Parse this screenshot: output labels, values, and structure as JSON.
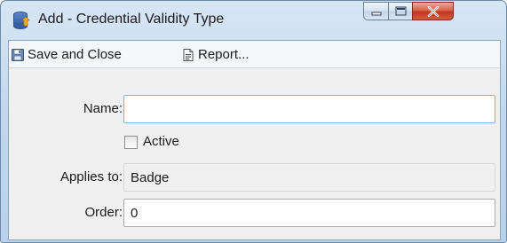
{
  "window": {
    "title": "Add - Credential Validity Type",
    "app_icon": "database-stack-icon",
    "caption_buttons": [
      "minimize-icon",
      "maximize-icon",
      "close-icon"
    ]
  },
  "toolbar": {
    "save_label": "Save and Close",
    "save_icon": "floppy-disk-icon",
    "report_label": "Report...",
    "report_icon": "report-document-icon"
  },
  "form": {
    "name": {
      "label": "Name:",
      "value": ""
    },
    "active": {
      "label": "Active",
      "checked": false
    },
    "applies_to": {
      "label": "Applies to:",
      "value": "Badge"
    },
    "order": {
      "label": "Order:",
      "value": "0"
    }
  },
  "colors": {
    "frame_blue": "#c3d8ee",
    "close_red": "#c2361c",
    "client_bg": "#f0f0f0",
    "focus_border": "#7eb4ea"
  }
}
